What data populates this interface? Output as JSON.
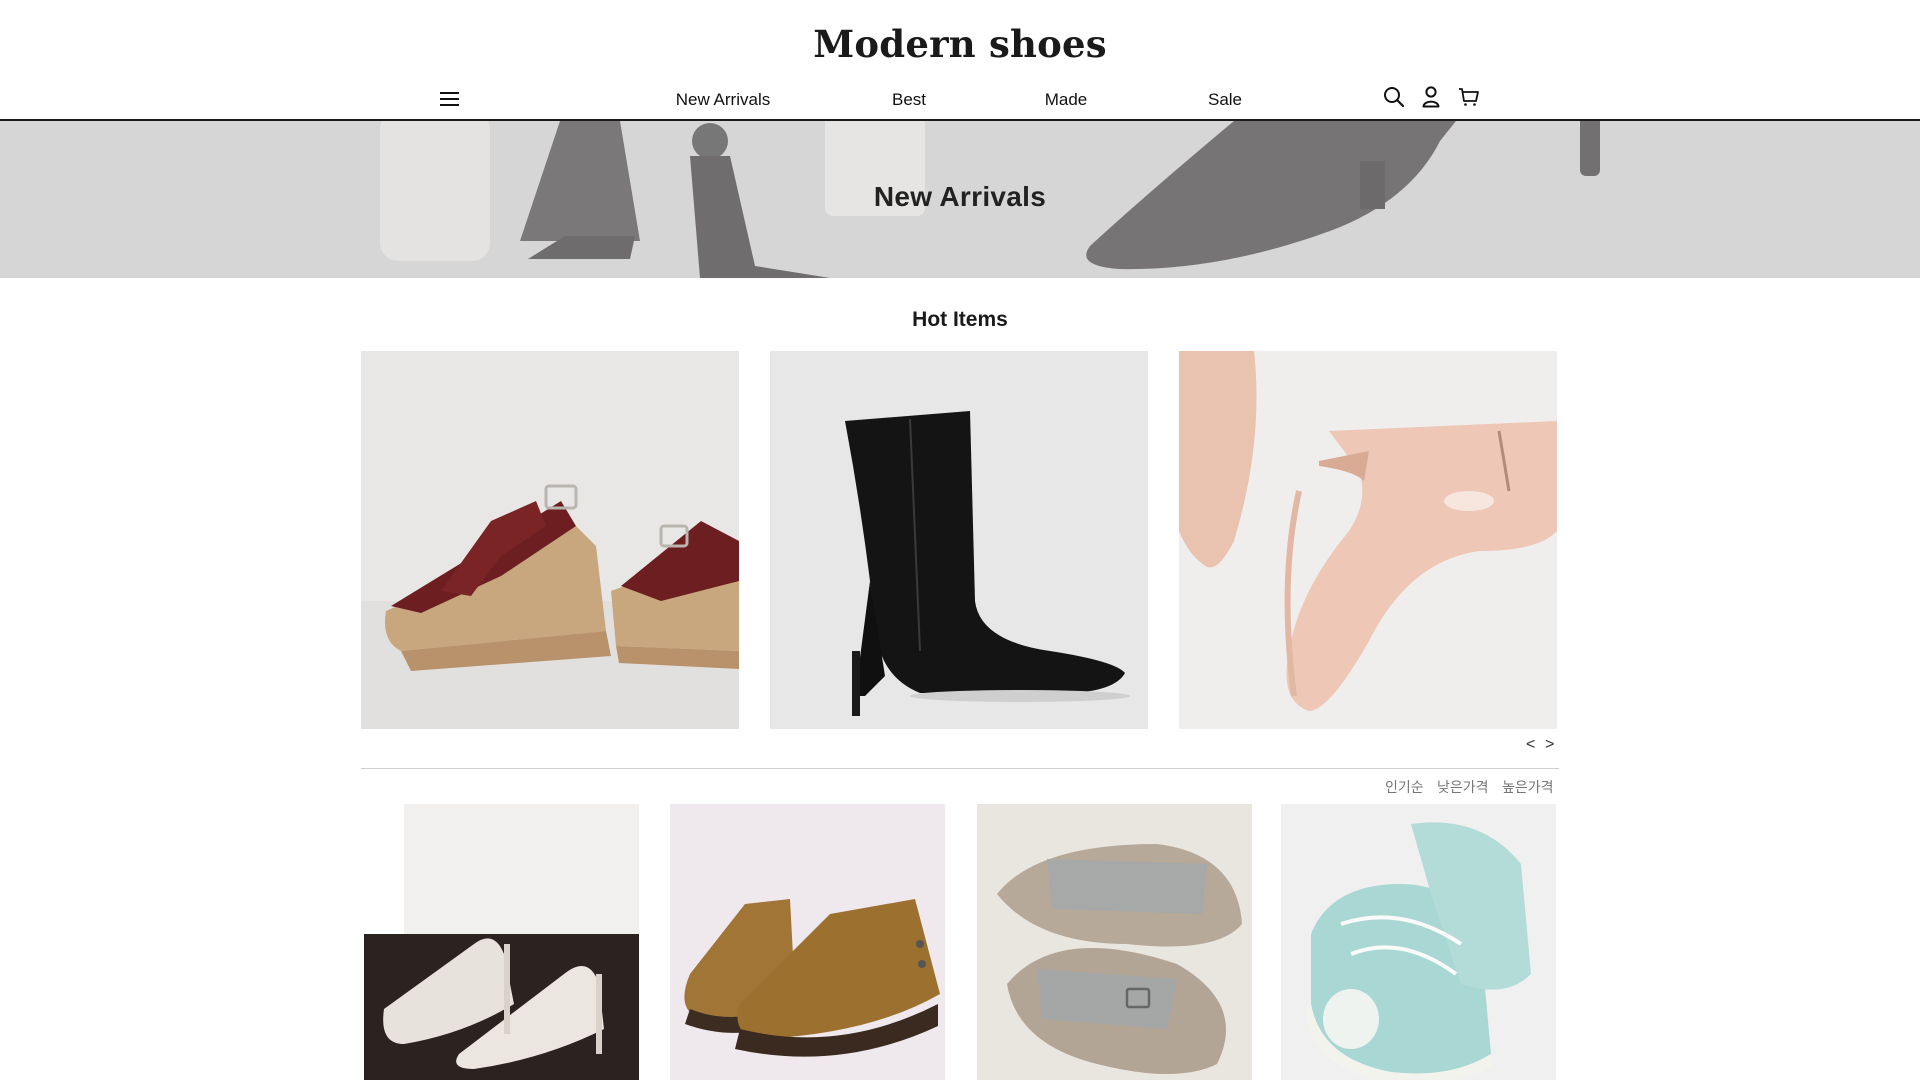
{
  "header": {
    "brand": "Modern shoes",
    "nav": [
      "New Arrivals",
      "Best",
      "Made",
      "Sale"
    ],
    "icons": [
      "menu-icon",
      "search-icon",
      "user-icon",
      "cart-icon"
    ]
  },
  "banner": {
    "title": "New Arrivals"
  },
  "hot_items": {
    "title": "Hot Items",
    "items": [
      "burgundy-platform-sandal",
      "black-stiletto-ankle-boot",
      "nude-patent-ankle-boot"
    ],
    "prev": "<",
    "next": ">"
  },
  "sort": {
    "options": [
      "인기순",
      "낮은가격",
      "높은가격"
    ]
  },
  "products": [
    "white-pumps",
    "tan-ankle-boots",
    "grey-strap-sandals",
    "mint-canvas-sneakers"
  ],
  "colors": {
    "banner_bg": "#d7d6d6",
    "header_rule": "#1b1b1b",
    "divider": "#cfcfcf"
  }
}
